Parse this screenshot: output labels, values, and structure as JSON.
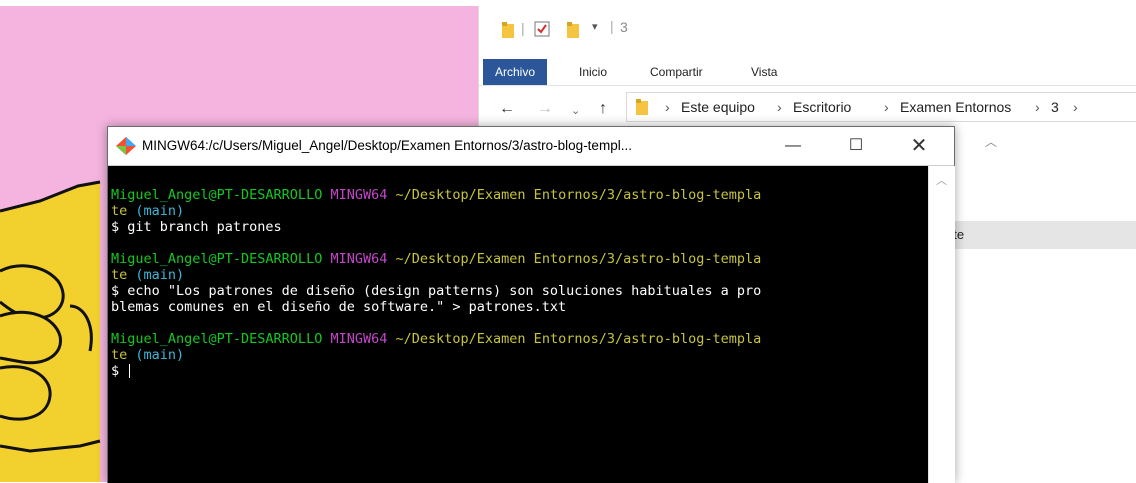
{
  "explorer": {
    "quick_access_number": "3",
    "tabs": [
      "Archivo",
      "Inicio",
      "Compartir",
      "Vista"
    ],
    "breadcrumbs": [
      "Este equipo",
      "Escritorio",
      "Examen Entornos",
      "3"
    ],
    "visible_file_fragment": "ate"
  },
  "terminal": {
    "title": "MINGW64:/c/Users/Miguel_Angel/Desktop/Examen Entornos/3/astro-blog-templ...",
    "prompt_user": "Miguel_Angel@PT-DESARROLLO",
    "prompt_env": "MINGW64",
    "prompt_path": "~/Desktop/Examen Entornos/3/astro-blog-templa",
    "prompt_path_wrap": "te",
    "prompt_branch": "(main)",
    "cmd1": "$ git branch patrones",
    "cmd2_line1": "$ echo \"Los patrones de diseño (design patterns) son soluciones habituales a pro",
    "cmd2_line2": "blemas comunes en el diseño de software.\" > patrones.txt",
    "final_prompt": "$"
  },
  "colors": {
    "prompt_user": "#13c823",
    "prompt_env": "#c346c9",
    "prompt_path": "#c7c43a",
    "branch": "#3cb6d9",
    "ribbon_active": "#2b579a"
  }
}
